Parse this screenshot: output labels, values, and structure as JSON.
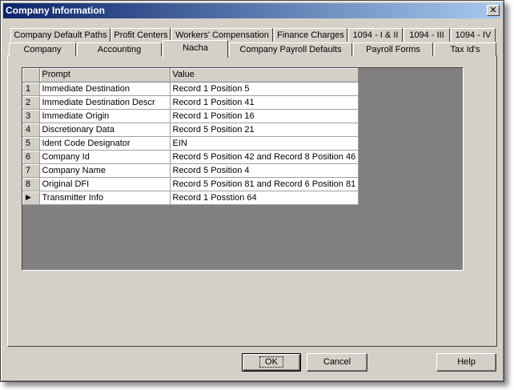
{
  "window": {
    "title": "Company Information",
    "close_glyph": "✕"
  },
  "tabs_row1": [
    {
      "label": "Company Default Paths"
    },
    {
      "label": "Profit Centers"
    },
    {
      "label": "Workers' Compensation"
    },
    {
      "label": "Finance Charges"
    },
    {
      "label": "1094 - I & II"
    },
    {
      "label": "1094 - III"
    },
    {
      "label": "1094 - IV"
    }
  ],
  "tabs_row2": [
    {
      "label": "Company"
    },
    {
      "label": "Accounting"
    },
    {
      "label": "Nacha",
      "active": true
    },
    {
      "label": "Company Payroll Defaults"
    },
    {
      "label": "Payroll Forms"
    },
    {
      "label": "Tax Id's"
    }
  ],
  "grid": {
    "columns": [
      "Prompt",
      "Value"
    ],
    "rows": [
      {
        "num": "1",
        "prompt": "Immediate Destination",
        "value": "Record 1 Position 5"
      },
      {
        "num": "2",
        "prompt": "Immediate Destination Descr",
        "value": "Record 1 Position 41"
      },
      {
        "num": "3",
        "prompt": "Immediate Origin",
        "value": "Record 1 Position 16"
      },
      {
        "num": "4",
        "prompt": "Discretionary Data",
        "value": "Record 5 Position 21"
      },
      {
        "num": "5",
        "prompt": "Ident Code Designator",
        "value": "EIN"
      },
      {
        "num": "6",
        "prompt": "Company Id",
        "value": "Record 5 Position 42 and Record 8 Position 46"
      },
      {
        "num": "7",
        "prompt": "Company Name",
        "value": "Record 5 Position 4"
      },
      {
        "num": "8",
        "prompt": "Original DFI",
        "value": "Record 5 Position 81 and Record 6 Position 81"
      },
      {
        "num": "▶",
        "prompt": "Transmitter Info",
        "value": "Record 1 Posstion 64"
      }
    ]
  },
  "buttons": {
    "ok": "OK",
    "cancel": "Cancel",
    "help": "Help"
  }
}
